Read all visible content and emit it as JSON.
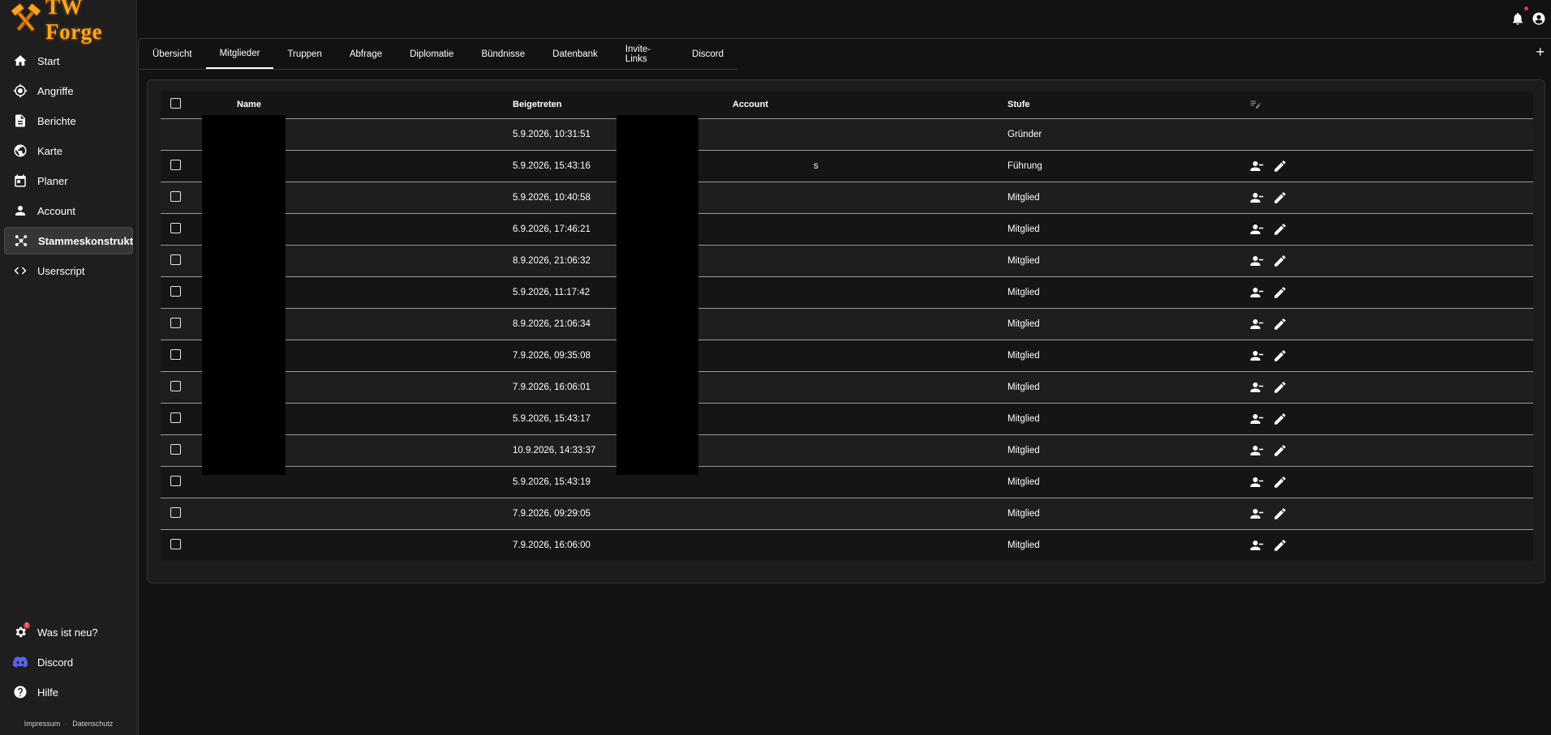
{
  "app": {
    "brand": "TW Forge"
  },
  "sidebar": {
    "items": [
      {
        "label": "Start",
        "icon": "home-icon"
      },
      {
        "label": "Angriffe",
        "icon": "crosshair-icon"
      },
      {
        "label": "Berichte",
        "icon": "document-icon"
      },
      {
        "label": "Karte",
        "icon": "globe-icon"
      },
      {
        "label": "Planer",
        "icon": "calendar-icon"
      },
      {
        "label": "Account",
        "icon": "person-icon"
      },
      {
        "label": "Stammeskonstrukt",
        "icon": "hub-icon",
        "active": true
      },
      {
        "label": "Userscript",
        "icon": "code-icon"
      }
    ],
    "bottom": [
      {
        "label": "Was ist neu?",
        "icon": "gear-notification-icon",
        "badge": "1"
      },
      {
        "label": "Discord",
        "icon": "discord-icon"
      },
      {
        "label": "Hilfe",
        "icon": "help-icon"
      }
    ],
    "footer": {
      "impressum": "Impressum",
      "datenschutz": "Datenschutz"
    }
  },
  "tabs": [
    "Übersicht",
    "Mitglieder",
    "Truppen",
    "Abfrage",
    "Diplomatie",
    "Bündnisse",
    "Datenbank",
    "Invite-Links",
    "Discord"
  ],
  "active_tab": "Mitglieder",
  "table": {
    "headers": {
      "name": "Name",
      "joined": "Beigetreten",
      "account": "Account",
      "rank": "Stufe"
    },
    "rows": [
      {
        "joined": "5.9.2026, 10:31:51",
        "account_suffix": "",
        "rank": "Gründer",
        "selectable": false,
        "actions": false
      },
      {
        "joined": "5.9.2026, 15:43:16",
        "account_suffix": "s",
        "rank": "Führung",
        "selectable": true,
        "actions": true
      },
      {
        "joined": "5.9.2026, 10:40:58",
        "account_suffix": "",
        "rank": "Mitglied",
        "selectable": true,
        "actions": true
      },
      {
        "joined": "6.9.2026, 17:46:21",
        "account_suffix": "",
        "rank": "Mitglied",
        "selectable": true,
        "actions": true
      },
      {
        "joined": "8.9.2026, 21:06:32",
        "account_suffix": "",
        "rank": "Mitglied",
        "selectable": true,
        "actions": true
      },
      {
        "joined": "5.9.2026, 11:17:42",
        "account_suffix": "",
        "rank": "Mitglied",
        "selectable": true,
        "actions": true
      },
      {
        "joined": "8.9.2026, 21:06:34",
        "account_suffix": "",
        "rank": "Mitglied",
        "selectable": true,
        "actions": true
      },
      {
        "joined": "7.9.2026, 09:35:08",
        "account_suffix": "",
        "rank": "Mitglied",
        "selectable": true,
        "actions": true
      },
      {
        "joined": "7.9.2026, 16:06:01",
        "account_suffix": "",
        "rank": "Mitglied",
        "selectable": true,
        "actions": true
      },
      {
        "joined": "5.9.2026, 15:43:17",
        "account_suffix": "",
        "rank": "Mitglied",
        "selectable": true,
        "actions": true
      },
      {
        "joined": "10.9.2026, 14:33:37",
        "account_suffix": "",
        "rank": "Mitglied",
        "selectable": true,
        "actions": true
      },
      {
        "joined": "5.9.2026, 15:43:19",
        "account_suffix": "",
        "rank": "Mitglied",
        "selectable": true,
        "actions": true
      },
      {
        "joined": "7.9.2026, 09:29:05",
        "account_suffix": "",
        "rank": "Mitglied",
        "selectable": true,
        "actions": true
      },
      {
        "joined": "7.9.2026, 16:06:00",
        "account_suffix": "",
        "rank": "Mitglied",
        "selectable": true,
        "actions": true
      }
    ]
  },
  "colors": {
    "background": "#121212",
    "sidebar": "#1e1e1e",
    "brand": "#f5a623",
    "discord": "#5865f2",
    "badge": "#e53935"
  }
}
